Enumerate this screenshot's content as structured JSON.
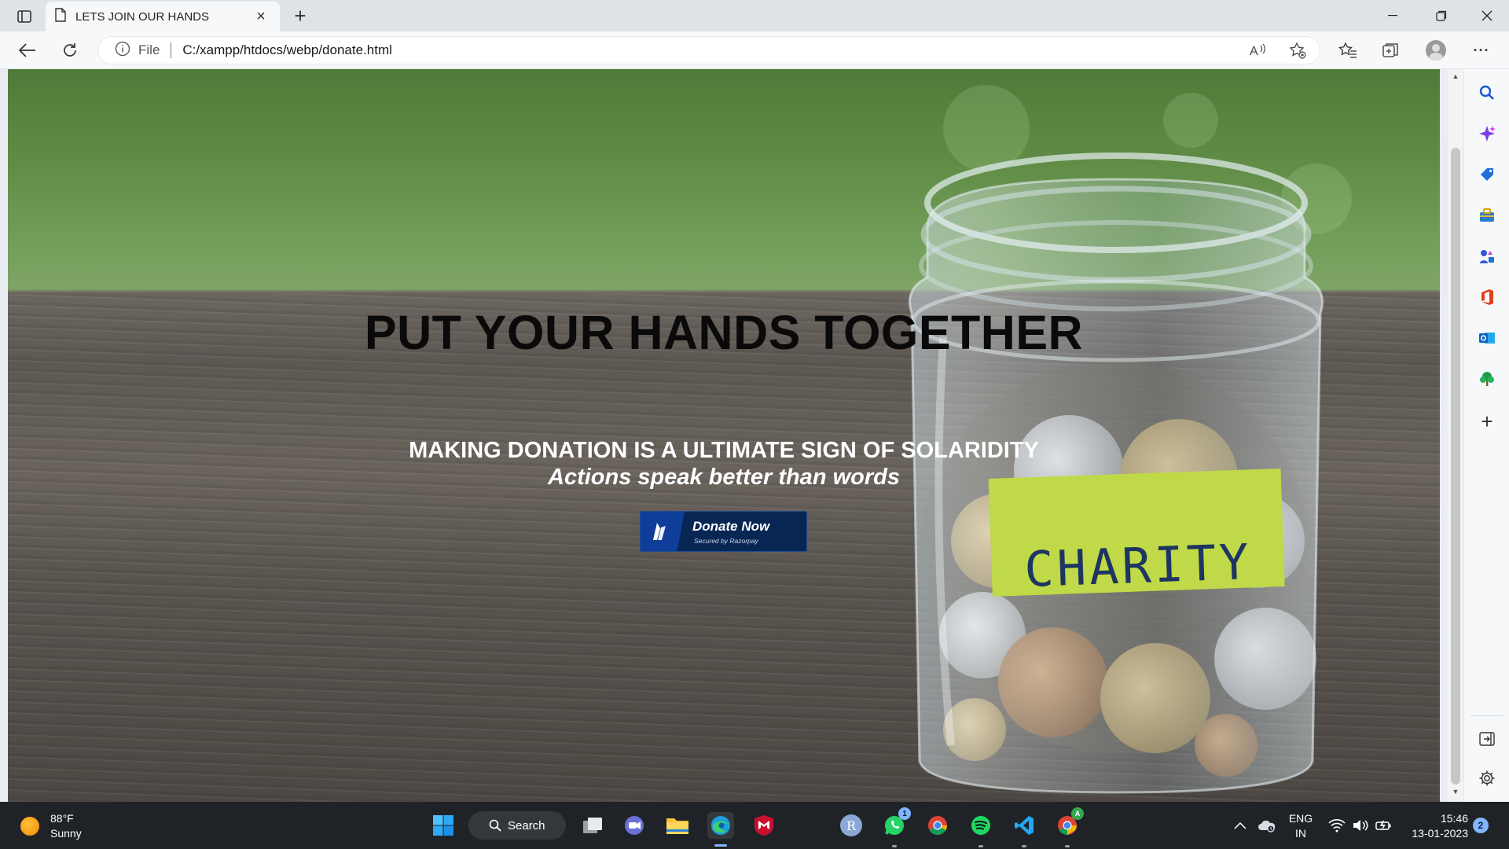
{
  "browser": {
    "tab_title": "LETS JOIN OUR HANDS",
    "new_tab_symbol": "+",
    "close_symbol": "×",
    "scheme_label": "File",
    "url": "C:/xampp/htdocs/webp/donate.html",
    "more_symbol": "···"
  },
  "page": {
    "headline": "PUT YOUR HANDS TOGETHER",
    "subline": "MAKING DONATION IS A ULTIMATE SIGN OF SOLARIDITY",
    "tagline": "Actions speak better than words",
    "jar_label": "CHARITY",
    "donate_button": {
      "label": "Donate Now",
      "secured": "Secured by Razorpay"
    }
  },
  "sidebar": {
    "add_symbol": "+"
  },
  "taskbar": {
    "weather_temp": "88°F",
    "weather_desc": "Sunny",
    "search_label": "Search",
    "whatsapp_badge": "1",
    "lang_top": "ENG",
    "lang_bottom": "IN",
    "time": "15:46",
    "date": "13-01-2023",
    "notification_count": "2",
    "avatar_letter": "R"
  },
  "colors": {
    "accent": "#0f3e9a",
    "donate_bg": "#072654",
    "taskbar_bg": "#1f2327"
  }
}
